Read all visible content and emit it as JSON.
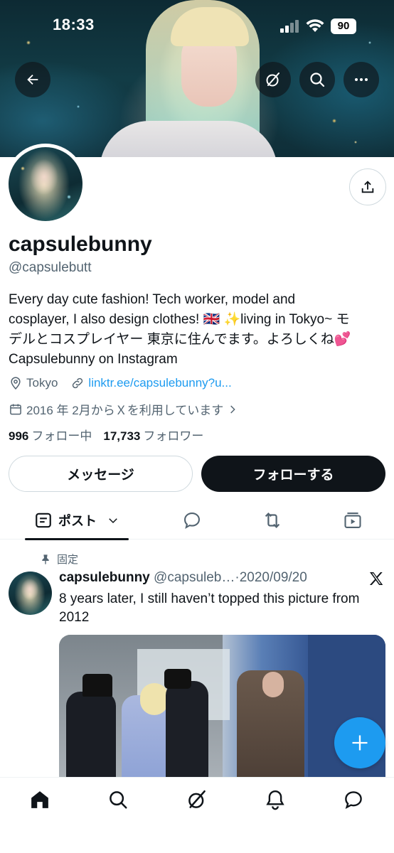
{
  "status_bar": {
    "time": "18:33",
    "battery": "90"
  },
  "profile": {
    "display_name": "capsulebunny",
    "handle": "@capsulebutt",
    "bio_line1": "Every day cute fashion! Tech worker, model and",
    "bio_line2_pre": "cosplayer, I also design clothes! ",
    "bio_flag": "🇬🇧",
    "bio_sparkle": "✨",
    "bio_line2_post": "living in Tokyo~ モ",
    "bio_line3": "デルとコスプレイヤー 東京に住んでます。よろしくね",
    "bio_heart": "💕",
    "bio_line4": "Capsulebunny on Instagram",
    "location": "Tokyo",
    "link": "linktr.ee/capsulebunny?u...",
    "joined": "2016 年 2月からＸを利用しています",
    "following_count": "996",
    "following_label": "フォロー中",
    "followers_count": "17,733",
    "followers_label": "フォロワー"
  },
  "actions": {
    "message": "メッセージ",
    "follow": "フォローする"
  },
  "tabs": {
    "posts": "ポスト"
  },
  "post": {
    "pinned_label": "固定",
    "name": "capsulebunny",
    "handle": "@capsuleb…",
    "dot": "·",
    "date": "2020/09/20",
    "text": "8 years later, I still haven’t topped this picture from 2012"
  },
  "icons": [
    "back-arrow-icon",
    "grok-icon",
    "search-icon",
    "more-icon",
    "share-icon",
    "location-pin-icon",
    "link-icon",
    "calendar-icon",
    "chevron-right-icon",
    "posts-tab-icon",
    "chevron-down-icon",
    "reply-tab-icon",
    "repost-tab-icon",
    "media-tab-icon",
    "pin-icon",
    "x-logo-icon",
    "plus-icon",
    "home-icon",
    "explore-icon",
    "grok-nav-icon",
    "notifications-icon",
    "messages-icon"
  ],
  "colors": {
    "accent": "#1d9bf0",
    "text": "#0f1419",
    "secondary": "#536471"
  }
}
